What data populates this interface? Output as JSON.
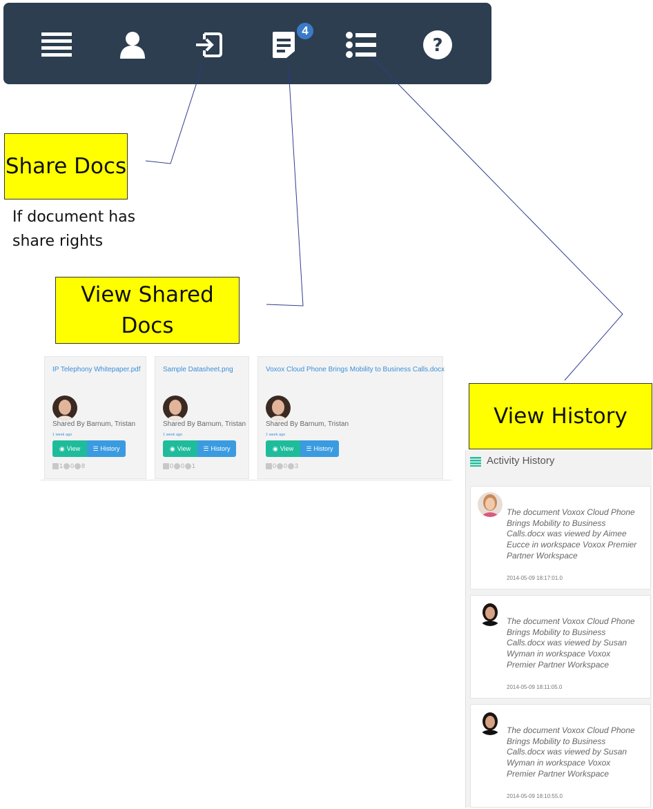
{
  "toolbar": {
    "buttons": [
      {
        "icon": "menu-icon"
      },
      {
        "icon": "user-icon"
      },
      {
        "icon": "share-icon"
      },
      {
        "icon": "shared-docs-icon",
        "badge": "4"
      },
      {
        "icon": "list-icon"
      },
      {
        "icon": "help-icon"
      }
    ],
    "colors": {
      "background": "#2c3e50",
      "badge": "#3a7bc8"
    }
  },
  "callouts": {
    "share_docs": "Share Docs",
    "share_docs_note": "If document has share rights",
    "view_shared_docs": "View Shared Docs",
    "view_history": "View History",
    "color": "#ffff00"
  },
  "cards": [
    {
      "title": "IP Telephony Whitepaper.pdf",
      "shared_by": "Shared By Barnum, Tristan",
      "ago": "1 week ago",
      "view": "View",
      "history": "History",
      "comments": "1",
      "alerts": "0",
      "views": "8"
    },
    {
      "title": "Sample Datasheet.png",
      "shared_by": "Shared By Barnum, Tristan",
      "ago": "1 week ago",
      "view": "View",
      "history": "History",
      "comments": "0",
      "alerts": "0",
      "views": "1"
    },
    {
      "title": "Voxox Cloud Phone Brings Mobility to Business Calls.docx",
      "shared_by": "Shared By Barnum, Tristan",
      "ago": "1 week ago",
      "view": "View",
      "history": "History",
      "comments": "0",
      "alerts": "0",
      "views": "3"
    }
  ],
  "history": {
    "title": "Activity History",
    "items": [
      {
        "text": "The document Voxox Cloud Phone Brings Mobility to Business Calls.docx was viewed by Aimee Eucce in workspace Voxox Premier Partner Workspace",
        "time": "2014-05-09 18:17:01.0"
      },
      {
        "text": "The document Voxox Cloud Phone Brings Mobility to Business Calls.docx was viewed by Susan Wyman in workspace Voxox Premier Partner Workspace",
        "time": "2014-05-09 18:11:05.0"
      },
      {
        "text": "The document Voxox Cloud Phone Brings Mobility to Business Calls.docx was viewed by Susan Wyman in workspace Voxox Premier Partner Workspace",
        "time": "2014-05-09 18:10:55.0"
      }
    ]
  }
}
